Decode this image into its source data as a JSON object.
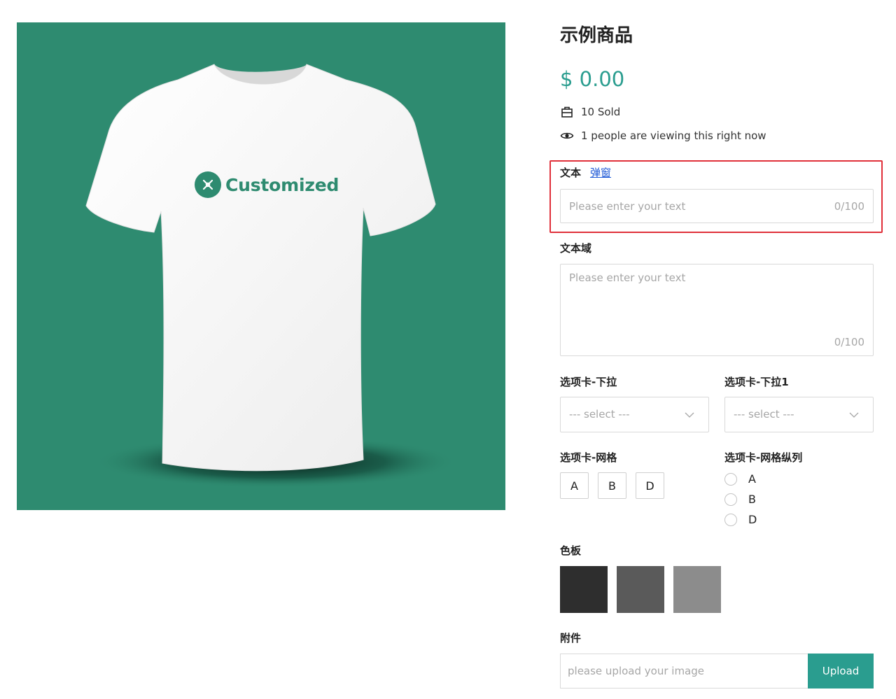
{
  "product": {
    "image_logo_text": "Customized",
    "title": "示例商品",
    "price": "$ 0.00",
    "sold": "10 Sold",
    "viewing": "1 people are viewing this right now"
  },
  "colors": {
    "accent": "#2a9d8f",
    "image_bg": "#2e8b70",
    "highlight": "#e0303a",
    "link": "#1a56d6"
  },
  "text_field": {
    "label": "文本",
    "popup_link": "弹窗",
    "placeholder": "Please enter your text",
    "counter": "0/100"
  },
  "textarea_field": {
    "label": "文本域",
    "placeholder": "Please enter your text",
    "counter": "0/100"
  },
  "dropdown_1": {
    "label": "选项卡-下拉",
    "value": "--- select ---"
  },
  "dropdown_2": {
    "label": "选项卡-下拉1",
    "value": "--- select ---"
  },
  "grid_options": {
    "label": "选项卡-网格",
    "options": [
      "A",
      "B",
      "D"
    ]
  },
  "radio_options": {
    "label": "选项卡-网格纵列",
    "options": [
      "A",
      "B",
      "D"
    ]
  },
  "palette": {
    "label": "色板",
    "swatches": [
      "#2e2e2e",
      "#5a5a5a",
      "#8c8c8c"
    ]
  },
  "attachment": {
    "label": "附件",
    "placeholder": "please upload your image",
    "button": "Upload"
  },
  "icons": {
    "sold": "bag-icon",
    "viewing": "eye-icon",
    "dropdown": "chevron-down-icon",
    "logo": "tools-icon"
  }
}
